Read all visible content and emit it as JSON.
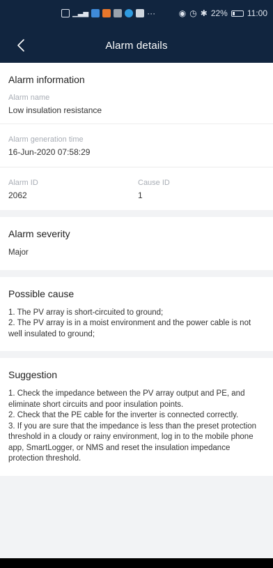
{
  "status_bar": {
    "battery": "22%",
    "time": "11:00",
    "icons": [
      "sim-icon",
      "signal-icon",
      "app-icon",
      "app-icon",
      "app-icon",
      "app-icon",
      "app-icon",
      "more-icon",
      "eye-icon",
      "alarm-clock-icon",
      "bluetooth-icon",
      "battery-icon"
    ]
  },
  "header": {
    "title": "Alarm details"
  },
  "alarm_info": {
    "title": "Alarm information",
    "name_label": "Alarm name",
    "name_value": "Low insulation resistance",
    "time_label": "Alarm generation time",
    "time_value": "16-Jun-2020 07:58:29",
    "id_label": "Alarm ID",
    "id_value": "2062",
    "cause_id_label": "Cause ID",
    "cause_id_value": "1"
  },
  "severity": {
    "title": "Alarm severity",
    "value": "Major"
  },
  "possible_cause": {
    "title": "Possible cause",
    "lines": [
      "1. The PV array is short-circuited to ground;",
      "2. The PV array is in a moist environment and the power cable is not well insulated to ground;"
    ]
  },
  "suggestion": {
    "title": "Suggestion",
    "lines": [
      "1. Check the impedance between the PV array output and PE, and eliminate short circuits and poor insulation points.",
      "2. Check that the PE cable for the inverter is connected correctly.",
      "3. If you are sure that the impedance is less than the preset protection threshold in a cloudy or rainy environment, log in to the mobile phone app, SmartLogger, or NMS and reset the insulation impedance protection threshold."
    ]
  }
}
